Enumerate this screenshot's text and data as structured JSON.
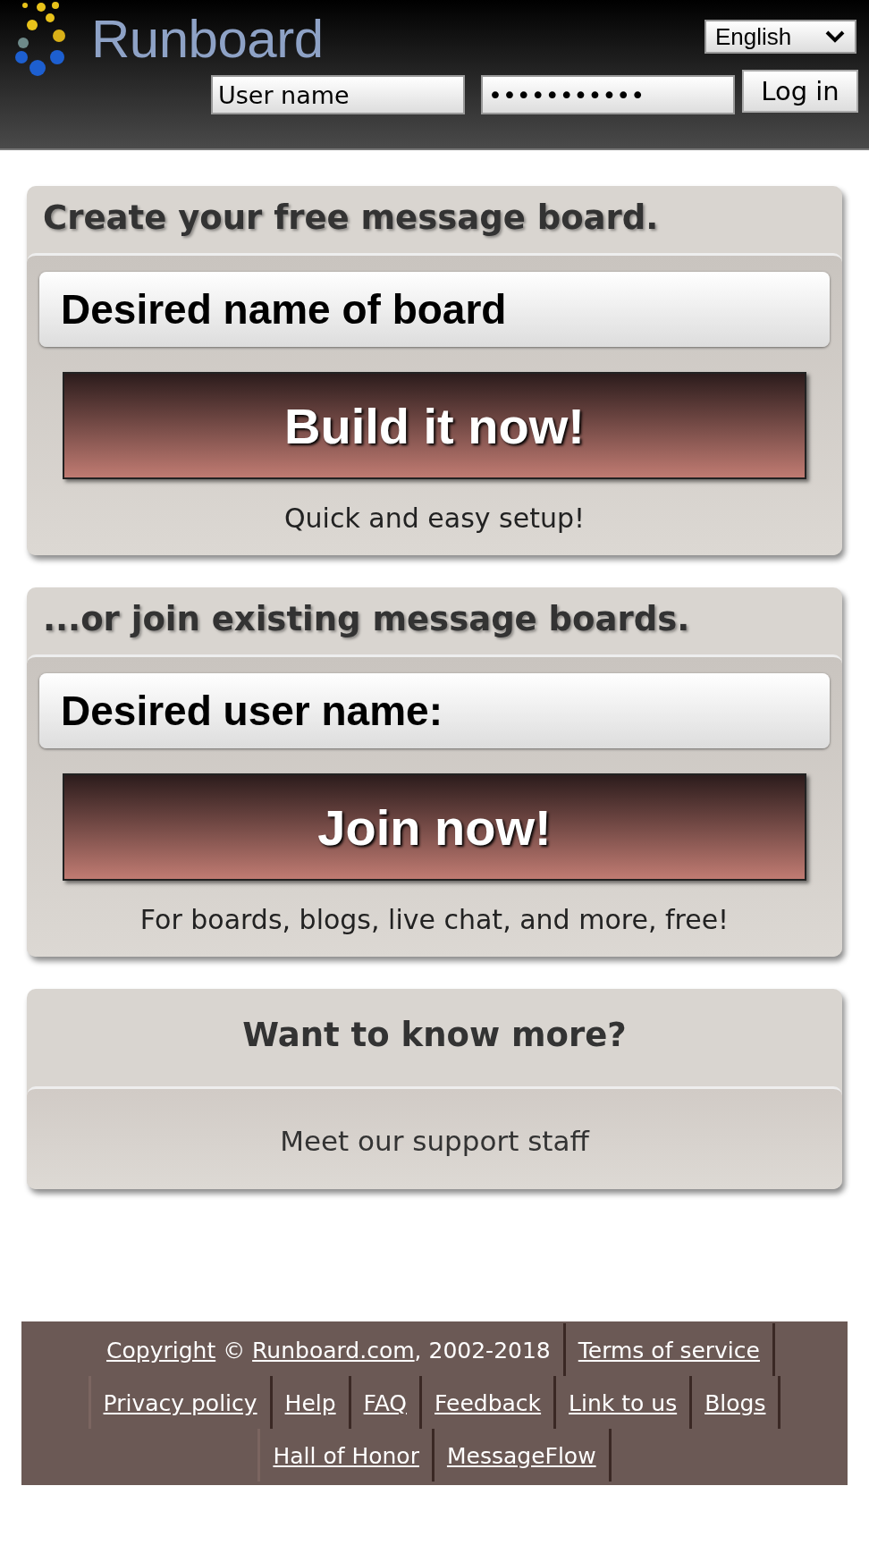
{
  "header": {
    "logo_text": "Runboard",
    "language": "English",
    "username": {
      "placeholder": "User name"
    },
    "password": {
      "value": "•••••••••••"
    },
    "login_button": "Log in"
  },
  "cards": [
    {
      "kind": "form",
      "title": "Create your free message board.",
      "field": {
        "placeholder": "Desired name of board"
      },
      "button": "Build it now!",
      "note": "Quick and easy setup!"
    },
    {
      "kind": "form",
      "title": "...or join existing message boards.",
      "field": {
        "placeholder": "Desired user name:"
      },
      "button": "Join now!",
      "note": "For boards, blogs, live chat, and more, free!"
    },
    {
      "kind": "info",
      "title": "Want to know more?",
      "link": "Meet our support staff"
    }
  ],
  "footer": {
    "copyright": {
      "link": "Copyright",
      "symbol": "©",
      "site_link": "Runboard.com",
      "years": ", 2002-2018"
    },
    "lines": [
      {
        "links": [
          "Terms of service"
        ]
      },
      {
        "links": [
          "Privacy policy",
          "Help",
          "FAQ",
          "Feedback",
          "Link to us",
          "Blogs"
        ]
      },
      {
        "links": [
          "Hall of Honor",
          "MessageFlow"
        ]
      }
    ]
  }
}
